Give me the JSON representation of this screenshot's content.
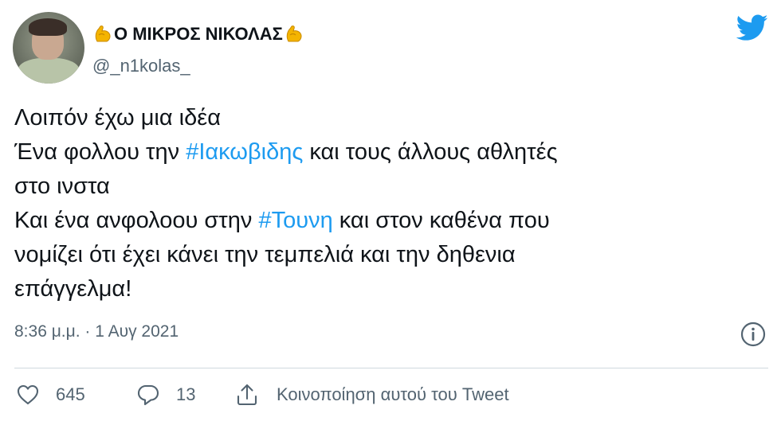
{
  "user": {
    "display_name": "Ο ΜΙΚΡΟΣ ΝΙΚΟΛΑΣ",
    "handle": "@_n1kolas_",
    "name_emoji": "flexed-biceps-icon"
  },
  "tweet": {
    "lines": [
      [
        {
          "text": "Λοιπόν έχω μια ιδέα"
        }
      ],
      [
        {
          "text": "Ένα φολλου την "
        },
        {
          "text": "#Ιακωβιδης",
          "hashtag": true
        },
        {
          "text": " και τους άλλους αθλητές"
        }
      ],
      [
        {
          "text": "στο ινστα"
        }
      ],
      [
        {
          "text": "Και ένα ανφολοου στην "
        },
        {
          "text": "#Τουνη",
          "hashtag": true
        },
        {
          "text": " και στον καθένα που"
        }
      ],
      [
        {
          "text": "νομίζει ότι έχει κάνει την τεμπελιά και την δηθενια"
        }
      ],
      [
        {
          "text": "επάγγελμα!"
        }
      ]
    ],
    "timestamp": "8:36 μ.μ. · 1 Αυγ 2021"
  },
  "actions": {
    "like_count": "645",
    "reply_count": "13",
    "share_label": "Κοινοποίηση αυτού του Tweet"
  },
  "colors": {
    "hashtag": "#1d9bf0",
    "twitter_blue": "#1d9bf0",
    "secondary_text": "#536471",
    "primary_text": "#0f1419"
  },
  "icons": {
    "brand": "twitter-bird-icon",
    "info": "info-icon",
    "like": "heart-icon",
    "reply": "reply-icon",
    "share": "share-icon"
  }
}
